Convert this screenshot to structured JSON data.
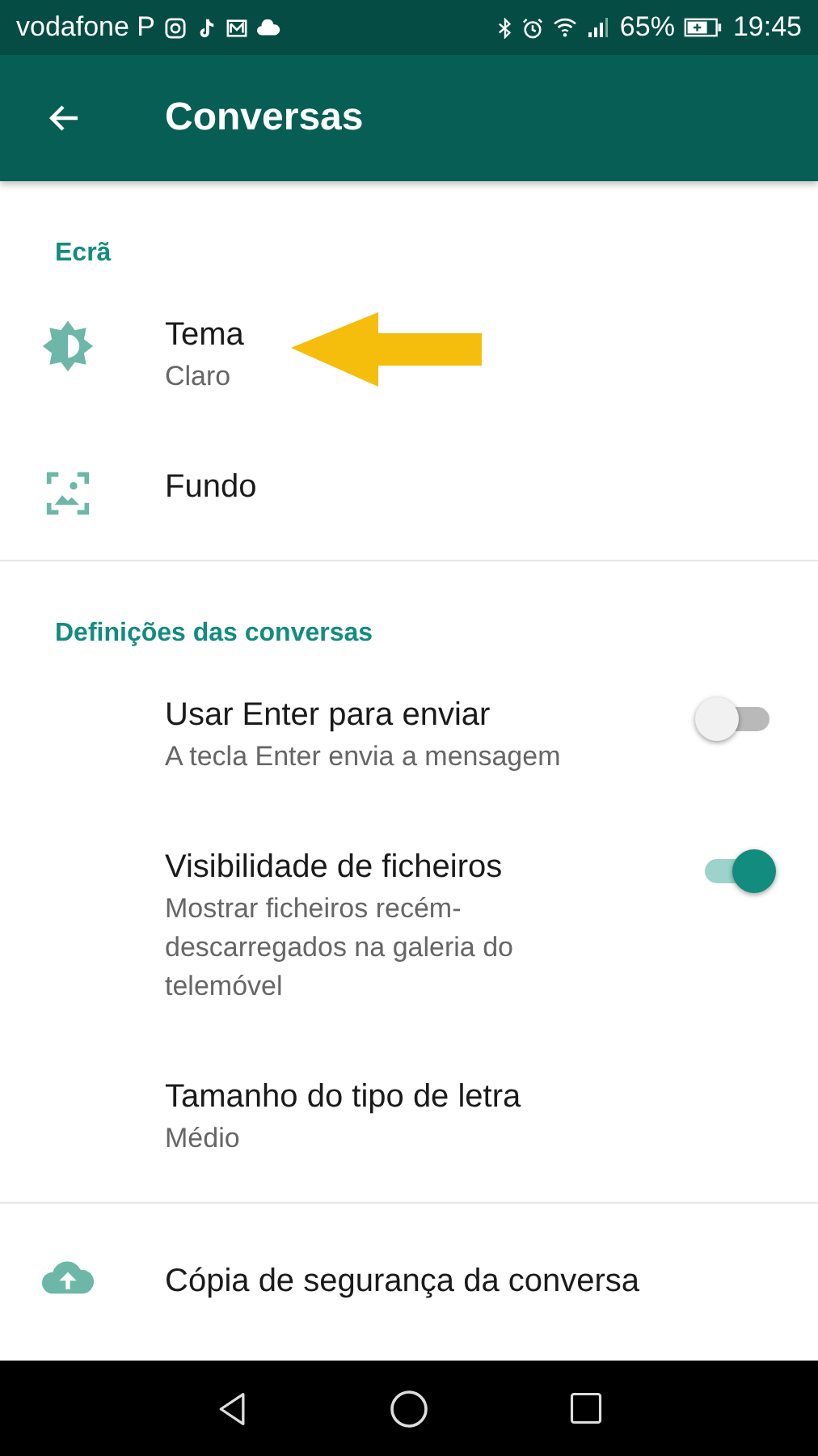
{
  "status_bar": {
    "carrier": "vodafone P",
    "battery": "65%",
    "time": "19:45"
  },
  "app_bar": {
    "title": "Conversas"
  },
  "sections": [
    {
      "header": "Ecrã",
      "items": [
        {
          "kind": "theme",
          "title": "Tema",
          "subtitle": "Claro"
        },
        {
          "kind": "wallpaper",
          "title": "Fundo"
        }
      ]
    },
    {
      "header": "Definições das conversas",
      "items": [
        {
          "kind": "toggle",
          "title": "Usar Enter para enviar",
          "subtitle": "A tecla Enter envia a mensagem",
          "on": false
        },
        {
          "kind": "toggle",
          "title": "Visibilidade de ficheiros",
          "subtitle": "Mostrar ficheiros recém-descarregados na galeria do telemóvel",
          "on": true
        },
        {
          "kind": "plain",
          "title": "Tamanho do tipo de letra",
          "subtitle": "Médio"
        }
      ]
    },
    {
      "items": [
        {
          "kind": "backup",
          "title": "Cópia de segurança da conversa"
        }
      ]
    }
  ]
}
